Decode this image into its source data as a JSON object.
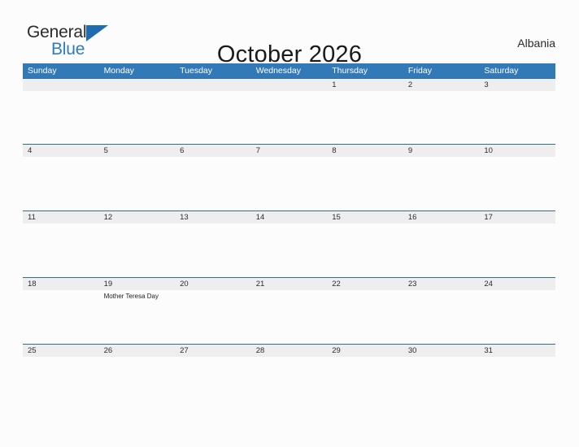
{
  "brand": {
    "line1": "General",
    "line2": "Blue",
    "flag_icon": "triangle-flag-icon",
    "accent_color": "#2b7cc4"
  },
  "header": {
    "title": "October 2026",
    "country": "Albania"
  },
  "theme": {
    "header_blue": "#3279b7",
    "row_gray": "#eeeeee",
    "page_bg": "#fcfcfc",
    "grid_line": "#2e6da4"
  },
  "calendar": {
    "month": "October",
    "year": "2026",
    "day_headers": [
      "Sunday",
      "Monday",
      "Tuesday",
      "Wednesday",
      "Thursday",
      "Friday",
      "Saturday"
    ],
    "weeks": [
      {
        "days": [
          {
            "date": "",
            "events": []
          },
          {
            "date": "",
            "events": []
          },
          {
            "date": "",
            "events": []
          },
          {
            "date": "",
            "events": []
          },
          {
            "date": "1",
            "events": []
          },
          {
            "date": "2",
            "events": []
          },
          {
            "date": "3",
            "events": []
          }
        ]
      },
      {
        "days": [
          {
            "date": "4",
            "events": []
          },
          {
            "date": "5",
            "events": []
          },
          {
            "date": "6",
            "events": []
          },
          {
            "date": "7",
            "events": []
          },
          {
            "date": "8",
            "events": []
          },
          {
            "date": "9",
            "events": []
          },
          {
            "date": "10",
            "events": []
          }
        ]
      },
      {
        "days": [
          {
            "date": "11",
            "events": []
          },
          {
            "date": "12",
            "events": []
          },
          {
            "date": "13",
            "events": []
          },
          {
            "date": "14",
            "events": []
          },
          {
            "date": "15",
            "events": []
          },
          {
            "date": "16",
            "events": []
          },
          {
            "date": "17",
            "events": []
          }
        ]
      },
      {
        "days": [
          {
            "date": "18",
            "events": []
          },
          {
            "date": "19",
            "events": [
              "Mother Teresa Day"
            ]
          },
          {
            "date": "20",
            "events": []
          },
          {
            "date": "21",
            "events": []
          },
          {
            "date": "22",
            "events": []
          },
          {
            "date": "23",
            "events": []
          },
          {
            "date": "24",
            "events": []
          }
        ]
      },
      {
        "days": [
          {
            "date": "25",
            "events": []
          },
          {
            "date": "26",
            "events": []
          },
          {
            "date": "27",
            "events": []
          },
          {
            "date": "28",
            "events": []
          },
          {
            "date": "29",
            "events": []
          },
          {
            "date": "30",
            "events": []
          },
          {
            "date": "31",
            "events": []
          }
        ]
      }
    ]
  }
}
